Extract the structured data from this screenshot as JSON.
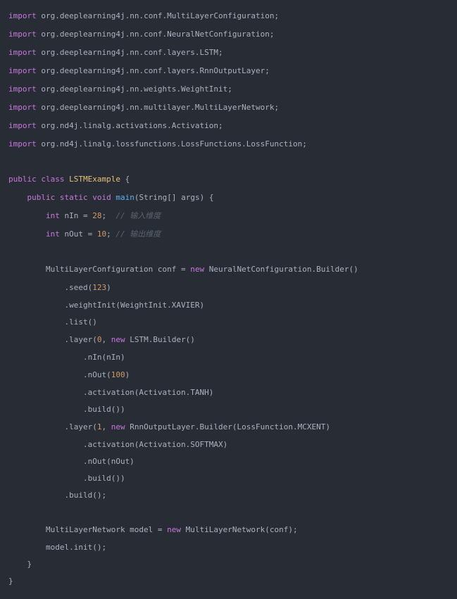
{
  "editor": {
    "language": "java",
    "background": "#282c34",
    "colors": {
      "kw": "#c678dd",
      "cls": "#e5c07b",
      "fn": "#61afef",
      "num": "#d19a66",
      "com": "#5c6370",
      "pl": "#abb2bf"
    },
    "lines": [
      [
        [
          "kw",
          "import"
        ],
        [
          "pl",
          " org.deeplearning4j.nn.conf.MultiLayerConfiguration;"
        ]
      ],
      [
        [
          "kw",
          "import"
        ],
        [
          "pl",
          " org.deeplearning4j.nn.conf.NeuralNetConfiguration;"
        ]
      ],
      [
        [
          "kw",
          "import"
        ],
        [
          "pl",
          " org.deeplearning4j.nn.conf.layers.LSTM;"
        ]
      ],
      [
        [
          "kw",
          "import"
        ],
        [
          "pl",
          " org.deeplearning4j.nn.conf.layers.RnnOutputLayer;"
        ]
      ],
      [
        [
          "kw",
          "import"
        ],
        [
          "pl",
          " org.deeplearning4j.nn.weights.WeightInit;"
        ]
      ],
      [
        [
          "kw",
          "import"
        ],
        [
          "pl",
          " org.deeplearning4j.nn.multilayer.MultiLayerNetwork;"
        ]
      ],
      [
        [
          "kw",
          "import"
        ],
        [
          "pl",
          " org.nd4j.linalg.activations.Activation;"
        ]
      ],
      [
        [
          "kw",
          "import"
        ],
        [
          "pl",
          " org.nd4j.linalg.lossfunctions.LossFunctions.LossFunction;"
        ]
      ],
      [
        [
          "kw",
          "public"
        ],
        [
          "pl",
          " "
        ],
        [
          "kw",
          "class"
        ],
        [
          "pl",
          " "
        ],
        [
          "cls",
          "LSTMExample"
        ],
        [
          "pl",
          " {"
        ]
      ],
      [
        [
          "pl",
          "    "
        ],
        [
          "kw",
          "public"
        ],
        [
          "pl",
          " "
        ],
        [
          "kw",
          "static"
        ],
        [
          "pl",
          " "
        ],
        [
          "kw",
          "void"
        ],
        [
          "pl",
          " "
        ],
        [
          "fn",
          "main"
        ],
        [
          "pl",
          "(String[] args) {"
        ]
      ],
      [
        [
          "pl",
          "        "
        ],
        [
          "kw",
          "int"
        ],
        [
          "pl",
          " nIn = "
        ],
        [
          "num",
          "28"
        ],
        [
          "pl",
          ";  "
        ],
        [
          "com",
          "// 输入维度"
        ]
      ],
      [
        [
          "pl",
          "        "
        ],
        [
          "kw",
          "int"
        ],
        [
          "pl",
          " nOut = "
        ],
        [
          "num",
          "10"
        ],
        [
          "pl",
          "; "
        ],
        [
          "com",
          "// 输出维度"
        ]
      ],
      [
        [
          "pl",
          "        MultiLayerConfiguration conf = "
        ],
        [
          "kw",
          "new"
        ],
        [
          "pl",
          " NeuralNetConfiguration.Builder()"
        ]
      ],
      [
        [
          "pl",
          "            .seed("
        ],
        [
          "num",
          "123"
        ],
        [
          "pl",
          ")"
        ]
      ],
      [
        [
          "pl",
          "            .weightInit(WeightInit.XAVIER)"
        ]
      ],
      [
        [
          "pl",
          "            .list()"
        ]
      ],
      [
        [
          "pl",
          "            .layer("
        ],
        [
          "num",
          "0"
        ],
        [
          "pl",
          ", "
        ],
        [
          "kw",
          "new"
        ],
        [
          "pl",
          " LSTM.Builder()"
        ]
      ],
      [
        [
          "pl",
          "                .nIn(nIn)"
        ]
      ],
      [
        [
          "pl",
          "                .nOut("
        ],
        [
          "num",
          "100"
        ],
        [
          "pl",
          ")"
        ]
      ],
      [
        [
          "pl",
          "                .activation(Activation.TANH)"
        ]
      ],
      [
        [
          "pl",
          "                .build())"
        ]
      ],
      [
        [
          "pl",
          "            .layer("
        ],
        [
          "num",
          "1"
        ],
        [
          "pl",
          ", "
        ],
        [
          "kw",
          "new"
        ],
        [
          "pl",
          " RnnOutputLayer.Builder(LossFunction.MCXENT)"
        ]
      ],
      [
        [
          "pl",
          "                .activation(Activation.SOFTMAX)"
        ]
      ],
      [
        [
          "pl",
          "                .nOut(nOut)"
        ]
      ],
      [
        [
          "pl",
          "                .build())"
        ]
      ],
      [
        [
          "pl",
          "            .build();"
        ]
      ],
      [
        [
          "pl",
          "        MultiLayerNetwork model = "
        ],
        [
          "kw",
          "new"
        ],
        [
          "pl",
          " MultiLayerNetwork(conf);"
        ]
      ],
      [
        [
          "pl",
          "        model.init();"
        ]
      ],
      [
        [
          "pl",
          "    }"
        ]
      ],
      [
        [
          "pl",
          "}"
        ]
      ]
    ]
  }
}
